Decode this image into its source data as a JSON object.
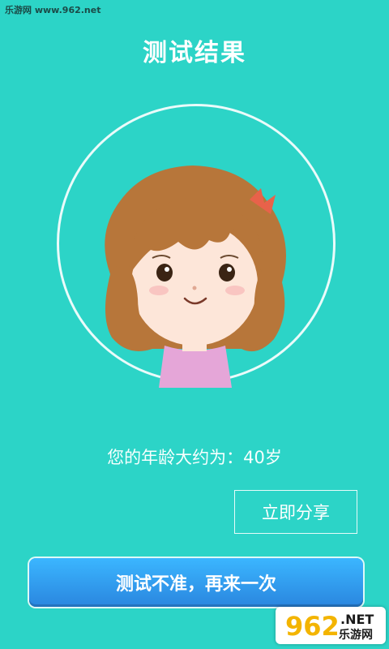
{
  "watermark": {
    "top_text": "乐游网 www.962.net"
  },
  "header": {
    "title": "测试结果"
  },
  "result": {
    "age_text": "您的年龄大约为：40岁"
  },
  "buttons": {
    "share_label": "立即分享",
    "retry_label": "测试不准，再来一次"
  },
  "logo": {
    "numbers": "962",
    "net": ".NET",
    "site": "乐游网"
  },
  "colors": {
    "background": "#2cd4c7",
    "retry_button": "#2f9ff0"
  }
}
